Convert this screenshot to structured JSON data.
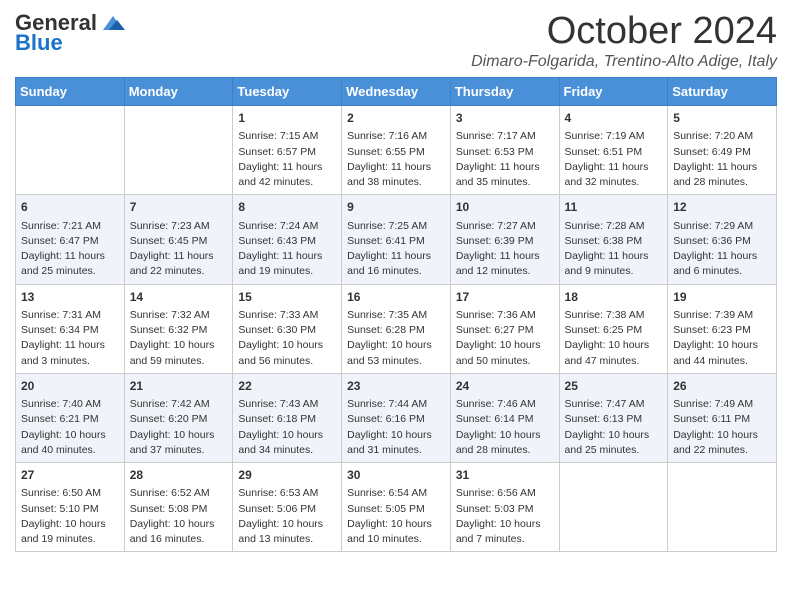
{
  "header": {
    "logo_general": "General",
    "logo_blue": "Blue",
    "month": "October 2024",
    "location": "Dimaro-Folgarida, Trentino-Alto Adige, Italy"
  },
  "days_of_week": [
    "Sunday",
    "Monday",
    "Tuesday",
    "Wednesday",
    "Thursday",
    "Friday",
    "Saturday"
  ],
  "weeks": [
    [
      {
        "day": "",
        "sunrise": "",
        "sunset": "",
        "daylight": ""
      },
      {
        "day": "",
        "sunrise": "",
        "sunset": "",
        "daylight": ""
      },
      {
        "day": "1",
        "sunrise": "Sunrise: 7:15 AM",
        "sunset": "Sunset: 6:57 PM",
        "daylight": "Daylight: 11 hours and 42 minutes."
      },
      {
        "day": "2",
        "sunrise": "Sunrise: 7:16 AM",
        "sunset": "Sunset: 6:55 PM",
        "daylight": "Daylight: 11 hours and 38 minutes."
      },
      {
        "day": "3",
        "sunrise": "Sunrise: 7:17 AM",
        "sunset": "Sunset: 6:53 PM",
        "daylight": "Daylight: 11 hours and 35 minutes."
      },
      {
        "day": "4",
        "sunrise": "Sunrise: 7:19 AM",
        "sunset": "Sunset: 6:51 PM",
        "daylight": "Daylight: 11 hours and 32 minutes."
      },
      {
        "day": "5",
        "sunrise": "Sunrise: 7:20 AM",
        "sunset": "Sunset: 6:49 PM",
        "daylight": "Daylight: 11 hours and 28 minutes."
      }
    ],
    [
      {
        "day": "6",
        "sunrise": "Sunrise: 7:21 AM",
        "sunset": "Sunset: 6:47 PM",
        "daylight": "Daylight: 11 hours and 25 minutes."
      },
      {
        "day": "7",
        "sunrise": "Sunrise: 7:23 AM",
        "sunset": "Sunset: 6:45 PM",
        "daylight": "Daylight: 11 hours and 22 minutes."
      },
      {
        "day": "8",
        "sunrise": "Sunrise: 7:24 AM",
        "sunset": "Sunset: 6:43 PM",
        "daylight": "Daylight: 11 hours and 19 minutes."
      },
      {
        "day": "9",
        "sunrise": "Sunrise: 7:25 AM",
        "sunset": "Sunset: 6:41 PM",
        "daylight": "Daylight: 11 hours and 16 minutes."
      },
      {
        "day": "10",
        "sunrise": "Sunrise: 7:27 AM",
        "sunset": "Sunset: 6:39 PM",
        "daylight": "Daylight: 11 hours and 12 minutes."
      },
      {
        "day": "11",
        "sunrise": "Sunrise: 7:28 AM",
        "sunset": "Sunset: 6:38 PM",
        "daylight": "Daylight: 11 hours and 9 minutes."
      },
      {
        "day": "12",
        "sunrise": "Sunrise: 7:29 AM",
        "sunset": "Sunset: 6:36 PM",
        "daylight": "Daylight: 11 hours and 6 minutes."
      }
    ],
    [
      {
        "day": "13",
        "sunrise": "Sunrise: 7:31 AM",
        "sunset": "Sunset: 6:34 PM",
        "daylight": "Daylight: 11 hours and 3 minutes."
      },
      {
        "day": "14",
        "sunrise": "Sunrise: 7:32 AM",
        "sunset": "Sunset: 6:32 PM",
        "daylight": "Daylight: 10 hours and 59 minutes."
      },
      {
        "day": "15",
        "sunrise": "Sunrise: 7:33 AM",
        "sunset": "Sunset: 6:30 PM",
        "daylight": "Daylight: 10 hours and 56 minutes."
      },
      {
        "day": "16",
        "sunrise": "Sunrise: 7:35 AM",
        "sunset": "Sunset: 6:28 PM",
        "daylight": "Daylight: 10 hours and 53 minutes."
      },
      {
        "day": "17",
        "sunrise": "Sunrise: 7:36 AM",
        "sunset": "Sunset: 6:27 PM",
        "daylight": "Daylight: 10 hours and 50 minutes."
      },
      {
        "day": "18",
        "sunrise": "Sunrise: 7:38 AM",
        "sunset": "Sunset: 6:25 PM",
        "daylight": "Daylight: 10 hours and 47 minutes."
      },
      {
        "day": "19",
        "sunrise": "Sunrise: 7:39 AM",
        "sunset": "Sunset: 6:23 PM",
        "daylight": "Daylight: 10 hours and 44 minutes."
      }
    ],
    [
      {
        "day": "20",
        "sunrise": "Sunrise: 7:40 AM",
        "sunset": "Sunset: 6:21 PM",
        "daylight": "Daylight: 10 hours and 40 minutes."
      },
      {
        "day": "21",
        "sunrise": "Sunrise: 7:42 AM",
        "sunset": "Sunset: 6:20 PM",
        "daylight": "Daylight: 10 hours and 37 minutes."
      },
      {
        "day": "22",
        "sunrise": "Sunrise: 7:43 AM",
        "sunset": "Sunset: 6:18 PM",
        "daylight": "Daylight: 10 hours and 34 minutes."
      },
      {
        "day": "23",
        "sunrise": "Sunrise: 7:44 AM",
        "sunset": "Sunset: 6:16 PM",
        "daylight": "Daylight: 10 hours and 31 minutes."
      },
      {
        "day": "24",
        "sunrise": "Sunrise: 7:46 AM",
        "sunset": "Sunset: 6:14 PM",
        "daylight": "Daylight: 10 hours and 28 minutes."
      },
      {
        "day": "25",
        "sunrise": "Sunrise: 7:47 AM",
        "sunset": "Sunset: 6:13 PM",
        "daylight": "Daylight: 10 hours and 25 minutes."
      },
      {
        "day": "26",
        "sunrise": "Sunrise: 7:49 AM",
        "sunset": "Sunset: 6:11 PM",
        "daylight": "Daylight: 10 hours and 22 minutes."
      }
    ],
    [
      {
        "day": "27",
        "sunrise": "Sunrise: 6:50 AM",
        "sunset": "Sunset: 5:10 PM",
        "daylight": "Daylight: 10 hours and 19 minutes."
      },
      {
        "day": "28",
        "sunrise": "Sunrise: 6:52 AM",
        "sunset": "Sunset: 5:08 PM",
        "daylight": "Daylight: 10 hours and 16 minutes."
      },
      {
        "day": "29",
        "sunrise": "Sunrise: 6:53 AM",
        "sunset": "Sunset: 5:06 PM",
        "daylight": "Daylight: 10 hours and 13 minutes."
      },
      {
        "day": "30",
        "sunrise": "Sunrise: 6:54 AM",
        "sunset": "Sunset: 5:05 PM",
        "daylight": "Daylight: 10 hours and 10 minutes."
      },
      {
        "day": "31",
        "sunrise": "Sunrise: 6:56 AM",
        "sunset": "Sunset: 5:03 PM",
        "daylight": "Daylight: 10 hours and 7 minutes."
      },
      {
        "day": "",
        "sunrise": "",
        "sunset": "",
        "daylight": ""
      },
      {
        "day": "",
        "sunrise": "",
        "sunset": "",
        "daylight": ""
      }
    ]
  ]
}
